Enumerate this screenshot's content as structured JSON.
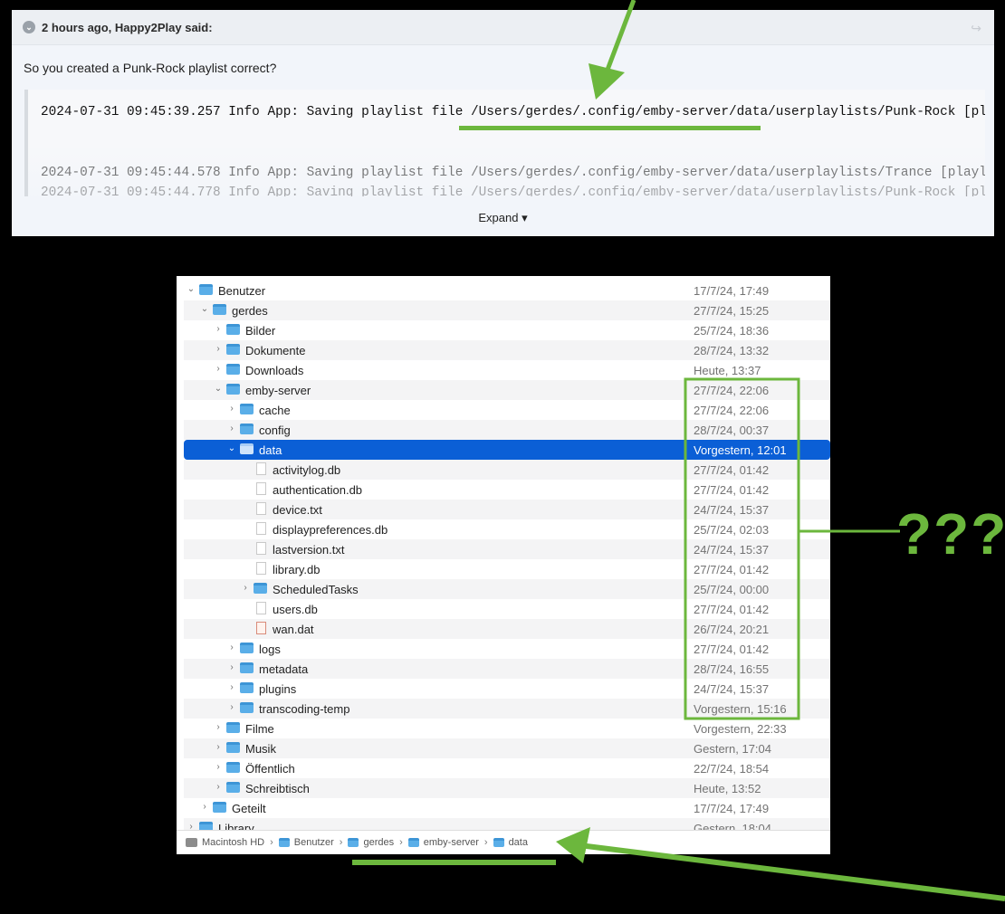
{
  "quote": {
    "header": "2 hours ago, Happy2Play said:",
    "text": "So you created a Punk-Rock playlist correct?",
    "code_lines": [
      "2024-07-31 09:45:39.257 Info App: Saving playlist file /Users/gerdes/.config/emby-server/data/userplaylists/Punk-Rock [playlist]",
      "2024-07-31 09:45:44.578 Info App: Saving playlist file /Users/gerdes/.config/emby-server/data/userplaylists/Trance [playlist]",
      "2024-07-31 09:45:44.778 Info App: Saving playlist file /Users/gerdes/.config/emby-server/data/userplaylists/Punk-Rock [playlist]"
    ],
    "expand_label": "Expand ▾"
  },
  "finder": {
    "rows": [
      {
        "name": "Benutzer",
        "date": "17/7/24, 17:49",
        "level": 0,
        "chev": "v",
        "kind": "folder"
      },
      {
        "name": "gerdes",
        "date": "27/7/24, 15:25",
        "level": 1,
        "chev": "v",
        "kind": "folder"
      },
      {
        "name": "Bilder",
        "date": "25/7/24, 18:36",
        "level": 2,
        "chev": ">",
        "kind": "folder"
      },
      {
        "name": "Dokumente",
        "date": "28/7/24, 13:32",
        "level": 2,
        "chev": ">",
        "kind": "folder"
      },
      {
        "name": "Downloads",
        "date": "Heute, 13:37",
        "level": 2,
        "chev": ">",
        "kind": "folder"
      },
      {
        "name": "emby-server",
        "date": "27/7/24, 22:06",
        "level": 2,
        "chev": "v",
        "kind": "folder"
      },
      {
        "name": "cache",
        "date": "27/7/24, 22:06",
        "level": 3,
        "chev": ">",
        "kind": "folder"
      },
      {
        "name": "config",
        "date": "28/7/24, 00:37",
        "level": 3,
        "chev": ">",
        "kind": "folder"
      },
      {
        "name": "data",
        "date": "Vorgestern, 12:01",
        "level": 3,
        "chev": "v",
        "kind": "folder",
        "selected": true
      },
      {
        "name": "activitylog.db",
        "date": "27/7/24, 01:42",
        "level": 4,
        "chev": "",
        "kind": "file"
      },
      {
        "name": "authentication.db",
        "date": "27/7/24, 01:42",
        "level": 4,
        "chev": "",
        "kind": "file"
      },
      {
        "name": "device.txt",
        "date": "24/7/24, 15:37",
        "level": 4,
        "chev": "",
        "kind": "file"
      },
      {
        "name": "displaypreferences.db",
        "date": "25/7/24, 02:03",
        "level": 4,
        "chev": "",
        "kind": "file"
      },
      {
        "name": "lastversion.txt",
        "date": "24/7/24, 15:37",
        "level": 4,
        "chev": "",
        "kind": "file"
      },
      {
        "name": "library.db",
        "date": "27/7/24, 01:42",
        "level": 4,
        "chev": "",
        "kind": "file"
      },
      {
        "name": "ScheduledTasks",
        "date": "25/7/24, 00:00",
        "level": 4,
        "chev": ">",
        "kind": "folder"
      },
      {
        "name": "users.db",
        "date": "27/7/24, 01:42",
        "level": 4,
        "chev": "",
        "kind": "file"
      },
      {
        "name": "wan.dat",
        "date": "26/7/24, 20:21",
        "level": 4,
        "chev": "",
        "kind": "file-red"
      },
      {
        "name": "logs",
        "date": "27/7/24, 01:42",
        "level": 3,
        "chev": ">",
        "kind": "folder"
      },
      {
        "name": "metadata",
        "date": "28/7/24, 16:55",
        "level": 3,
        "chev": ">",
        "kind": "folder"
      },
      {
        "name": "plugins",
        "date": "24/7/24, 15:37",
        "level": 3,
        "chev": ">",
        "kind": "folder"
      },
      {
        "name": "transcoding-temp",
        "date": "Vorgestern, 15:16",
        "level": 3,
        "chev": ">",
        "kind": "folder"
      },
      {
        "name": "Filme",
        "date": "Vorgestern, 22:33",
        "level": 2,
        "chev": ">",
        "kind": "folder"
      },
      {
        "name": "Musik",
        "date": "Gestern, 17:04",
        "level": 2,
        "chev": ">",
        "kind": "folder"
      },
      {
        "name": "Öffentlich",
        "date": "22/7/24, 18:54",
        "level": 2,
        "chev": ">",
        "kind": "folder"
      },
      {
        "name": "Schreibtisch",
        "date": "Heute, 13:52",
        "level": 2,
        "chev": ">",
        "kind": "folder"
      },
      {
        "name": "Geteilt",
        "date": "17/7/24, 17:49",
        "level": 1,
        "chev": ">",
        "kind": "folder"
      },
      {
        "name": "Library",
        "date": "Gestern, 18:04",
        "level": 0,
        "chev": ">",
        "kind": "folder"
      }
    ],
    "path": [
      "Macintosh HD",
      "Benutzer",
      "gerdes",
      "emby-server",
      "data"
    ]
  },
  "annotation": {
    "text": "???"
  },
  "colors": {
    "highlight": "#6cb73d",
    "selection": "#0b5fd6"
  }
}
